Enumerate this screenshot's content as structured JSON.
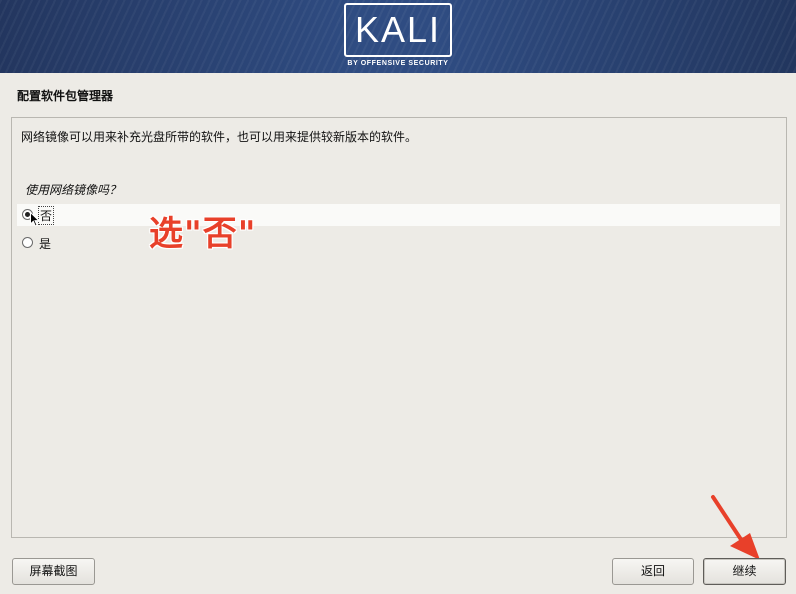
{
  "banner": {
    "logo_text": "KALI",
    "logo_subtitle": "BY OFFENSIVE SECURITY",
    "colors": {
      "start": "#23365f",
      "mid": "#2f4c82"
    }
  },
  "page": {
    "title": "配置软件包管理器",
    "description": "网络镜像可以用来补充光盘所带的软件，也可以用来提供较新版本的软件。",
    "question": "使用网络镜像吗？"
  },
  "options": [
    {
      "label": "否",
      "selected": true
    },
    {
      "label": "是",
      "selected": false
    }
  ],
  "annotation": {
    "text": "选\"否\"",
    "color": "#e8402a"
  },
  "buttons": {
    "screenshot": "屏幕截图",
    "back": "返回",
    "continue": "继续"
  }
}
